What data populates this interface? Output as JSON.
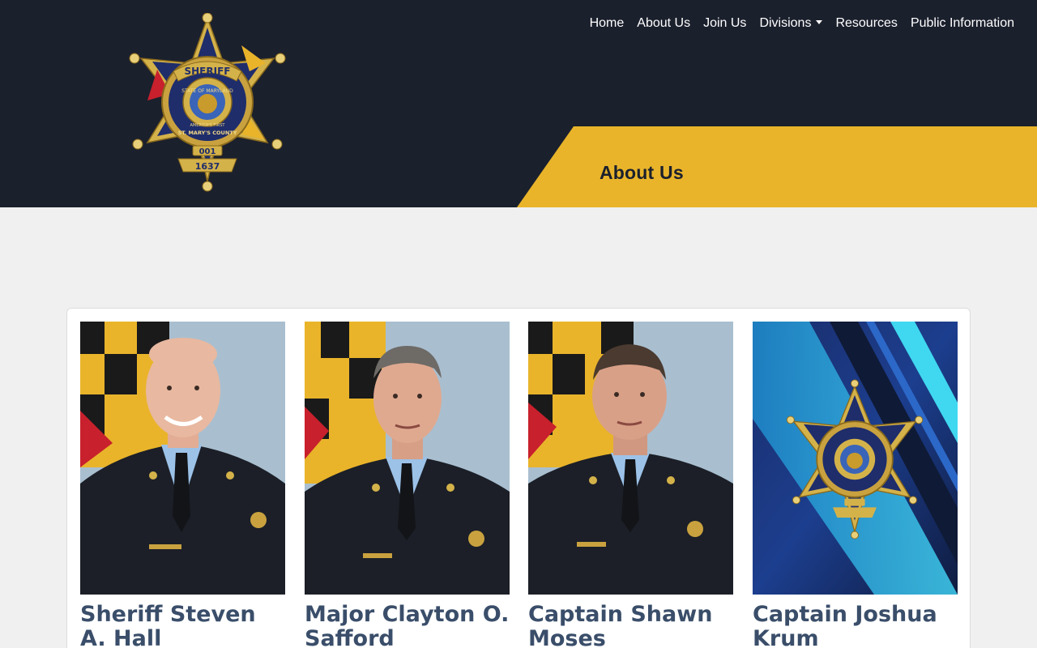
{
  "nav": {
    "items": [
      {
        "label": "Home"
      },
      {
        "label": "About Us"
      },
      {
        "label": "Join Us"
      },
      {
        "label": "Divisions",
        "dropdown": true
      },
      {
        "label": "Resources"
      },
      {
        "label": "Public Information"
      }
    ]
  },
  "badge": {
    "top_text": "SHERIFF",
    "ring_text": "STATE OF MARYLAND",
    "county_text": "ST. MARY'S COUNTY",
    "motto": "AMERICA'S FIRST",
    "number": "001",
    "since_label": "SINCE",
    "year": "1637"
  },
  "banner": {
    "title": "About Us"
  },
  "people": [
    {
      "name": "Sheriff Steven A. Hall"
    },
    {
      "name": "Major Clayton O. Safford"
    },
    {
      "name": "Captain Shawn Moses"
    },
    {
      "name": "Captain Joshua Krum"
    }
  ],
  "colors": {
    "header_bg": "#1b202d",
    "banner_gold": "#e9b42a",
    "name_color": "#3a4e6a",
    "page_bg": "#f0f0f0"
  },
  "icons": {
    "logo": "sheriff-star-badge-icon",
    "dropdown": "caret-down-icon"
  }
}
